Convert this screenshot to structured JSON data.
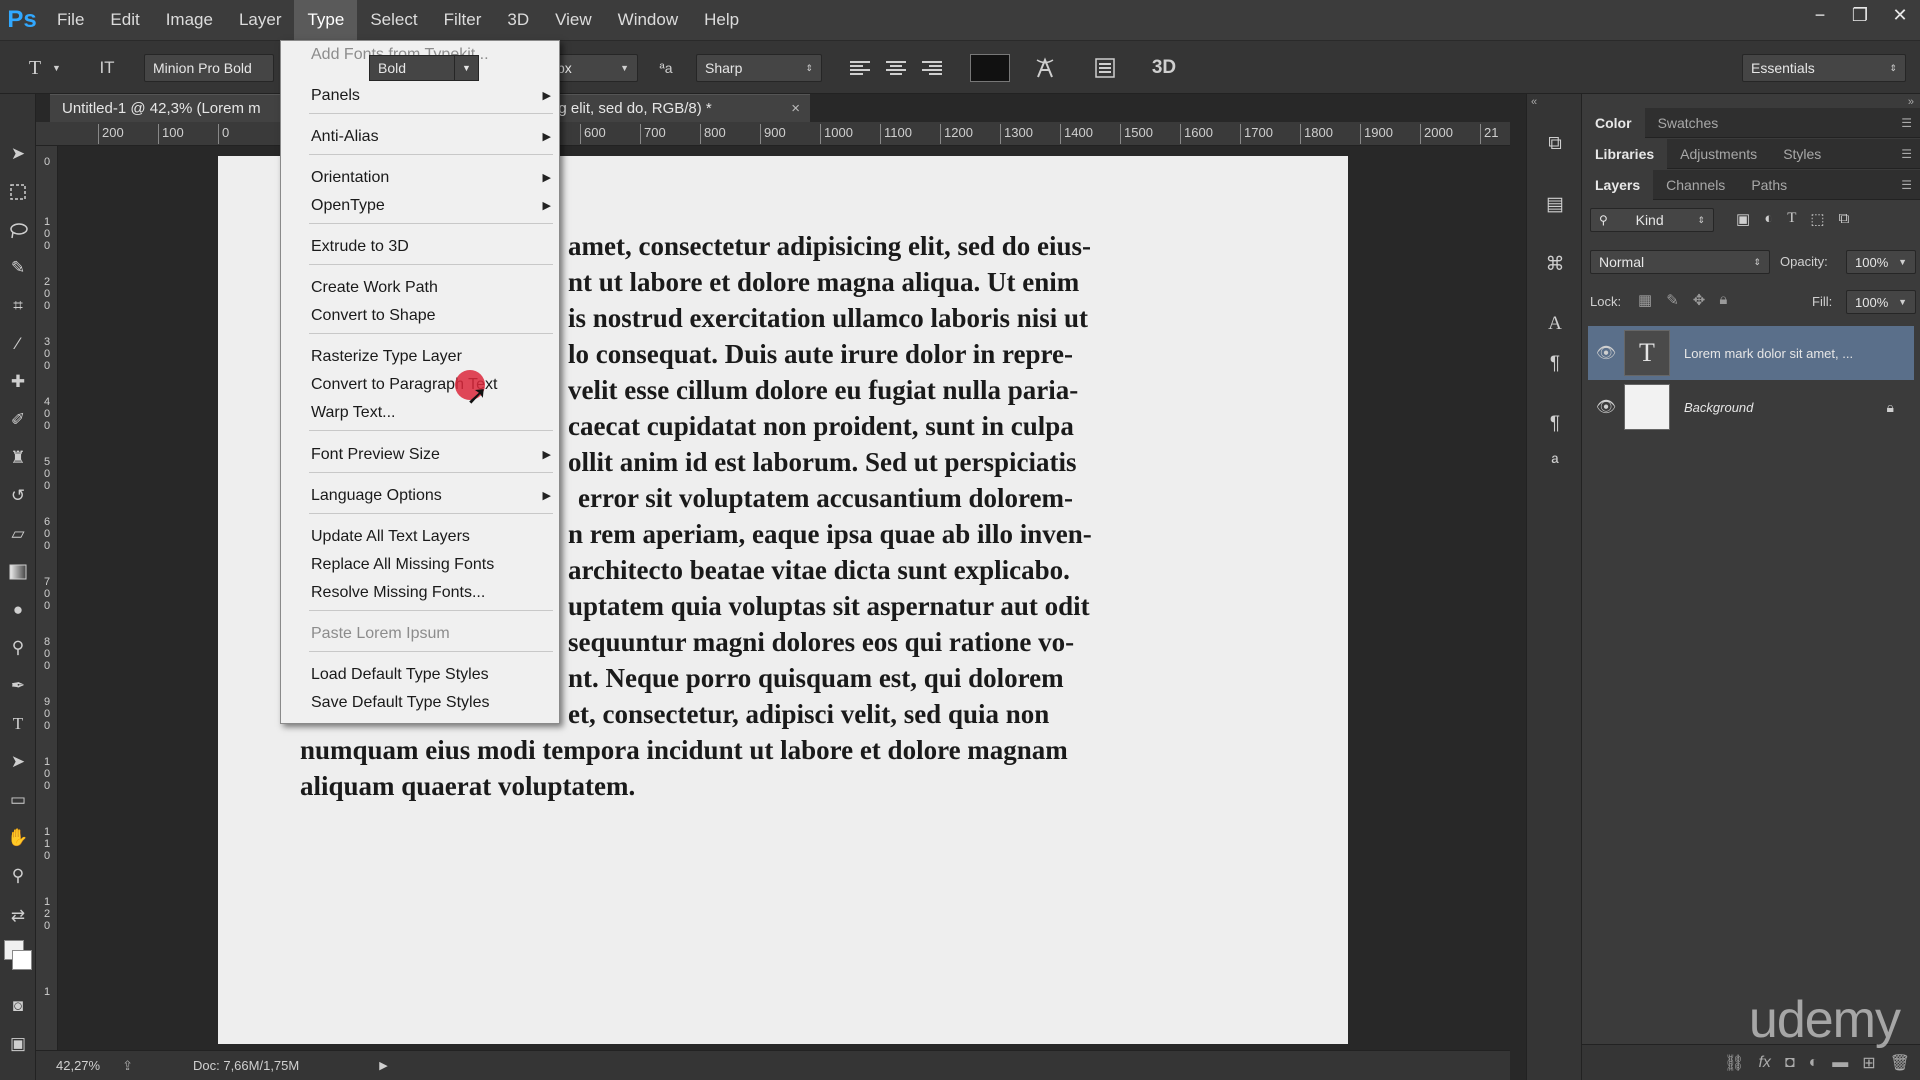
{
  "app": {
    "logo": "Ps"
  },
  "menubar": {
    "items": [
      "File",
      "Edit",
      "Image",
      "Layer",
      "Type",
      "Select",
      "Filter",
      "3D",
      "View",
      "Window",
      "Help"
    ],
    "active": "Type"
  },
  "window_controls": {
    "minimize": "−",
    "restore": "❐",
    "close": "✕"
  },
  "options": {
    "tool_glyph": "T",
    "orient_glyph": "IT",
    "font_family": "Minion Pro Bold",
    "font_style": "Bold",
    "size_unit": "px",
    "aa_glyph": "ªa",
    "anti_alias": "Sharp",
    "text_color": "#111111",
    "threed": "3D",
    "workspace": "Essentials"
  },
  "document": {
    "tab_title": "Untitled-1 @ 42,3% (Lorem m",
    "tab_title_end": "ng elit, sed do, RGB/8) *",
    "close": "×",
    "h_ruler": [
      "200",
      "100",
      "0",
      "600",
      "700",
      "800",
      "900",
      "1000",
      "1100",
      "1200",
      "1300",
      "1400",
      "1500",
      "1600",
      "1700",
      "1800",
      "1900",
      "2000",
      "21"
    ],
    "v_ruler": [
      "0",
      "1 0 0",
      "2 0 0",
      "3 0 0",
      "4 0 0",
      "5 0 0",
      "6 0 0",
      "7 0 0",
      "8 0 0",
      "9 0 0",
      "1 0 0",
      "1 1 0",
      "1 2 0",
      "1"
    ],
    "text_lines": [
      "amet, consectetur adipisicing elit, sed do eius-",
      "nt ut labore et dolore magna aliqua. Ut enim",
      "is nostrud exercitation ullamco laboris nisi ut",
      "lo consequat. Duis aute irure dolor in repre-",
      "velit esse cillum dolore eu fugiat nulla paria-",
      "caecat cupidatat non proident, sunt in culpa",
      "ollit anim id est laborum. Sed ut perspiciatis",
      "error sit voluptatem accusantium dolorem-",
      "n rem aperiam, eaque ipsa quae ab illo inven-",
      "architecto beatae vitae dicta sunt explicabo.",
      "uptatem quia voluptas sit aspernatur aut odit",
      "sequuntur magni dolores eos qui ratione vo-",
      "nt. Neque porro quisquam est, qui dolorem",
      "et, consectetur, adipisci velit, sed quia non",
      "numquam eius modi tempora incidunt ut labore et dolore magnam",
      "aliquam quaerat voluptatem."
    ]
  },
  "status": {
    "zoom": "42,27%",
    "doc": "Doc: 7,66M/1,75M",
    "arrow": "▶"
  },
  "watermark": "udemy",
  "type_menu": {
    "add_fonts": "Add Fonts from Typekit...",
    "panels": "Panels",
    "anti_alias": "Anti-Alias",
    "orientation": "Orientation",
    "opentype": "OpenType",
    "extrude": "Extrude to 3D",
    "create_work_path": "Create Work Path",
    "convert_shape": "Convert to Shape",
    "rasterize": "Rasterize Type Layer",
    "convert_paragraph": "Convert to Paragraph Text",
    "warp": "Warp Text...",
    "font_preview": "Font Preview Size",
    "language": "Language Options",
    "update_all": "Update All Text Layers",
    "replace_missing": "Replace All Missing Fonts",
    "resolve_missing": "Resolve Missing Fonts...",
    "paste_lorem": "Paste Lorem Ipsum",
    "load_default": "Load Default Type Styles",
    "save_default": "Save Default Type Styles"
  },
  "panels": {
    "row1": [
      "Color",
      "Swatches"
    ],
    "row2": [
      "Libraries",
      "Adjustments",
      "Styles"
    ],
    "row3": [
      "Layers",
      "Channels",
      "Paths"
    ],
    "kind": "Kind",
    "blend_mode": "Normal",
    "opacity_label": "Opacity:",
    "opacity": "100%",
    "lock_label": "Lock:",
    "fill_label": "Fill:",
    "fill": "100%",
    "layers": [
      {
        "name": "Lorem mark dolor sit amet, ...",
        "thumb": "T"
      },
      {
        "name": "Background",
        "thumb": ""
      }
    ]
  }
}
